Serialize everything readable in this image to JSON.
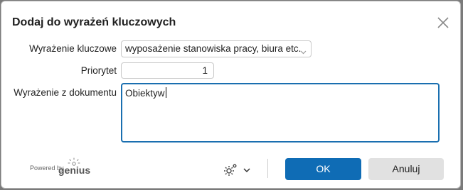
{
  "dialog": {
    "title": "Dodaj do wyrażeń kluczowych",
    "close_icon": "close-icon"
  },
  "form": {
    "keyword_label": "Wyrażenie kluczowe",
    "keyword_value": "wyposażenie stanowiska pracy, biura etc.",
    "priority_label": "Priorytet",
    "priority_value": "1",
    "document_expression_label": "Wyrażenie z dokumentu",
    "document_expression_value": "Obiektyw"
  },
  "footer": {
    "powered_by": "Powered by",
    "brand": "genius",
    "settings_icon": "gear-icon",
    "ok_label": "OK",
    "cancel_label": "Anuluj"
  },
  "colors": {
    "accent": "#0f6cb5",
    "focus_border": "#1a6fb0",
    "cancel_bg": "#e1e1e1"
  }
}
